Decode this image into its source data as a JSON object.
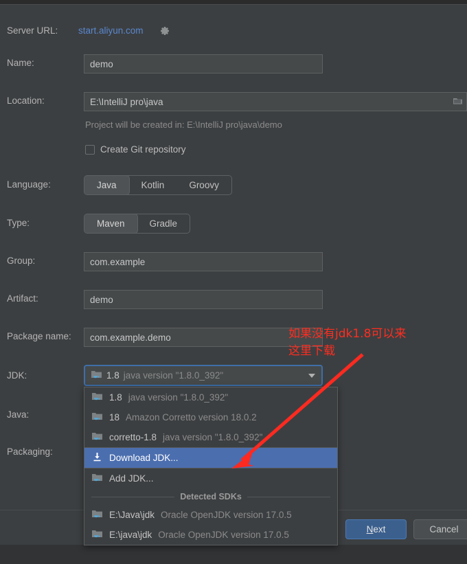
{
  "dialog": {
    "server_url_label": "Server URL:",
    "server_url_value": "start.aliyun.com",
    "settings_icon": "gear-icon",
    "name_label": "Name:",
    "name_value": "demo",
    "location_label": "Location:",
    "location_value": "E:\\IntelliJ pro\\java",
    "location_browse_icon": "folder-browse-icon",
    "location_hint": "Project will be created in: E:\\IntelliJ pro\\java\\demo",
    "git_checkbox_label": "Create Git repository",
    "git_checkbox_checked": false,
    "language_label": "Language:",
    "language_options": [
      "Java",
      "Kotlin",
      "Groovy"
    ],
    "language_selected": "Java",
    "type_label": "Type:",
    "type_options": [
      "Maven",
      "Gradle"
    ],
    "type_selected": "Maven",
    "group_label": "Group:",
    "group_value": "com.example",
    "artifact_label": "Artifact:",
    "artifact_value": "demo",
    "package_label": "Package name:",
    "package_value": "com.example.demo",
    "jdk_label": "JDK:",
    "jdk_selected_name": "1.8",
    "jdk_selected_desc": "java version \"1.8.0_392\"",
    "jdk_caret_icon": "chevron-down-icon",
    "java_label": "Java:",
    "packaging_label": "Packaging:"
  },
  "jdk_dropdown": {
    "items": [
      {
        "icon": "jdk-folder-icon",
        "name": "1.8",
        "desc": "java version \"1.8.0_392\"",
        "highlighted": false
      },
      {
        "icon": "jdk-folder-icon",
        "name": "18",
        "desc": "Amazon Corretto version 18.0.2",
        "highlighted": false
      },
      {
        "icon": "jdk-folder-icon",
        "name": "corretto-1.8",
        "desc": "java version \"1.8.0_392\"",
        "highlighted": false
      },
      {
        "icon": "download-icon",
        "name": "Download JDK...",
        "desc": "",
        "highlighted": true
      },
      {
        "icon": "jdk-folder-icon",
        "name": "Add JDK...",
        "desc": "",
        "highlighted": false
      }
    ],
    "group_header": "Detected SDKs",
    "detected": [
      {
        "icon": "jdk-folder-icon",
        "name": "E:\\Java\\jdk",
        "desc": "Oracle OpenJDK version 17.0.5"
      },
      {
        "icon": "jdk-folder-icon",
        "name": "E:\\java\\jdk",
        "desc": "Oracle OpenJDK version 17.0.5"
      }
    ]
  },
  "footer": {
    "next_mnemonic": "N",
    "next_rest": "ext",
    "cancel_label": "Cancel"
  },
  "annotation": {
    "line1": "如果没有jdk1.8可以来",
    "line2": "这里下载",
    "color": "#ff2d20",
    "arrow_icon": "red-arrow-icon"
  },
  "colors": {
    "background": "#3c3f41",
    "field_bg": "#45494a",
    "link": "#5a87cf",
    "focus_border": "#3e6ea8",
    "highlight": "#4b6eaf",
    "annotation_red": "#ff2d20"
  }
}
